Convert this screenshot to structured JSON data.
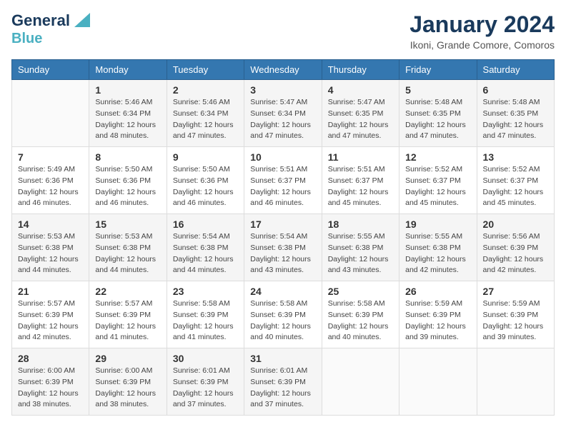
{
  "logo": {
    "line1": "General",
    "line2": "Blue"
  },
  "title": "January 2024",
  "subtitle": "Ikoni, Grande Comore, Comoros",
  "days_of_week": [
    "Sunday",
    "Monday",
    "Tuesday",
    "Wednesday",
    "Thursday",
    "Friday",
    "Saturday"
  ],
  "weeks": [
    [
      {
        "day": "",
        "sunrise": "",
        "sunset": "",
        "daylight": "",
        "extra": ""
      },
      {
        "day": "1",
        "sunrise": "Sunrise: 5:46 AM",
        "sunset": "Sunset: 6:34 PM",
        "daylight": "Daylight: 12 hours",
        "extra": "and 48 minutes."
      },
      {
        "day": "2",
        "sunrise": "Sunrise: 5:46 AM",
        "sunset": "Sunset: 6:34 PM",
        "daylight": "Daylight: 12 hours",
        "extra": "and 47 minutes."
      },
      {
        "day": "3",
        "sunrise": "Sunrise: 5:47 AM",
        "sunset": "Sunset: 6:34 PM",
        "daylight": "Daylight: 12 hours",
        "extra": "and 47 minutes."
      },
      {
        "day": "4",
        "sunrise": "Sunrise: 5:47 AM",
        "sunset": "Sunset: 6:35 PM",
        "daylight": "Daylight: 12 hours",
        "extra": "and 47 minutes."
      },
      {
        "day": "5",
        "sunrise": "Sunrise: 5:48 AM",
        "sunset": "Sunset: 6:35 PM",
        "daylight": "Daylight: 12 hours",
        "extra": "and 47 minutes."
      },
      {
        "day": "6",
        "sunrise": "Sunrise: 5:48 AM",
        "sunset": "Sunset: 6:35 PM",
        "daylight": "Daylight: 12 hours",
        "extra": "and 47 minutes."
      }
    ],
    [
      {
        "day": "7",
        "sunrise": "Sunrise: 5:49 AM",
        "sunset": "Sunset: 6:36 PM",
        "daylight": "Daylight: 12 hours",
        "extra": "and 46 minutes."
      },
      {
        "day": "8",
        "sunrise": "Sunrise: 5:50 AM",
        "sunset": "Sunset: 6:36 PM",
        "daylight": "Daylight: 12 hours",
        "extra": "and 46 minutes."
      },
      {
        "day": "9",
        "sunrise": "Sunrise: 5:50 AM",
        "sunset": "Sunset: 6:36 PM",
        "daylight": "Daylight: 12 hours",
        "extra": "and 46 minutes."
      },
      {
        "day": "10",
        "sunrise": "Sunrise: 5:51 AM",
        "sunset": "Sunset: 6:37 PM",
        "daylight": "Daylight: 12 hours",
        "extra": "and 46 minutes."
      },
      {
        "day": "11",
        "sunrise": "Sunrise: 5:51 AM",
        "sunset": "Sunset: 6:37 PM",
        "daylight": "Daylight: 12 hours",
        "extra": "and 45 minutes."
      },
      {
        "day": "12",
        "sunrise": "Sunrise: 5:52 AM",
        "sunset": "Sunset: 6:37 PM",
        "daylight": "Daylight: 12 hours",
        "extra": "and 45 minutes."
      },
      {
        "day": "13",
        "sunrise": "Sunrise: 5:52 AM",
        "sunset": "Sunset: 6:37 PM",
        "daylight": "Daylight: 12 hours",
        "extra": "and 45 minutes."
      }
    ],
    [
      {
        "day": "14",
        "sunrise": "Sunrise: 5:53 AM",
        "sunset": "Sunset: 6:38 PM",
        "daylight": "Daylight: 12 hours",
        "extra": "and 44 minutes."
      },
      {
        "day": "15",
        "sunrise": "Sunrise: 5:53 AM",
        "sunset": "Sunset: 6:38 PM",
        "daylight": "Daylight: 12 hours",
        "extra": "and 44 minutes."
      },
      {
        "day": "16",
        "sunrise": "Sunrise: 5:54 AM",
        "sunset": "Sunset: 6:38 PM",
        "daylight": "Daylight: 12 hours",
        "extra": "and 44 minutes."
      },
      {
        "day": "17",
        "sunrise": "Sunrise: 5:54 AM",
        "sunset": "Sunset: 6:38 PM",
        "daylight": "Daylight: 12 hours",
        "extra": "and 43 minutes."
      },
      {
        "day": "18",
        "sunrise": "Sunrise: 5:55 AM",
        "sunset": "Sunset: 6:38 PM",
        "daylight": "Daylight: 12 hours",
        "extra": "and 43 minutes."
      },
      {
        "day": "19",
        "sunrise": "Sunrise: 5:55 AM",
        "sunset": "Sunset: 6:38 PM",
        "daylight": "Daylight: 12 hours",
        "extra": "and 42 minutes."
      },
      {
        "day": "20",
        "sunrise": "Sunrise: 5:56 AM",
        "sunset": "Sunset: 6:39 PM",
        "daylight": "Daylight: 12 hours",
        "extra": "and 42 minutes."
      }
    ],
    [
      {
        "day": "21",
        "sunrise": "Sunrise: 5:57 AM",
        "sunset": "Sunset: 6:39 PM",
        "daylight": "Daylight: 12 hours",
        "extra": "and 42 minutes."
      },
      {
        "day": "22",
        "sunrise": "Sunrise: 5:57 AM",
        "sunset": "Sunset: 6:39 PM",
        "daylight": "Daylight: 12 hours",
        "extra": "and 41 minutes."
      },
      {
        "day": "23",
        "sunrise": "Sunrise: 5:58 AM",
        "sunset": "Sunset: 6:39 PM",
        "daylight": "Daylight: 12 hours",
        "extra": "and 41 minutes."
      },
      {
        "day": "24",
        "sunrise": "Sunrise: 5:58 AM",
        "sunset": "Sunset: 6:39 PM",
        "daylight": "Daylight: 12 hours",
        "extra": "and 40 minutes."
      },
      {
        "day": "25",
        "sunrise": "Sunrise: 5:58 AM",
        "sunset": "Sunset: 6:39 PM",
        "daylight": "Daylight: 12 hours",
        "extra": "and 40 minutes."
      },
      {
        "day": "26",
        "sunrise": "Sunrise: 5:59 AM",
        "sunset": "Sunset: 6:39 PM",
        "daylight": "Daylight: 12 hours",
        "extra": "and 39 minutes."
      },
      {
        "day": "27",
        "sunrise": "Sunrise: 5:59 AM",
        "sunset": "Sunset: 6:39 PM",
        "daylight": "Daylight: 12 hours",
        "extra": "and 39 minutes."
      }
    ],
    [
      {
        "day": "28",
        "sunrise": "Sunrise: 6:00 AM",
        "sunset": "Sunset: 6:39 PM",
        "daylight": "Daylight: 12 hours",
        "extra": "and 38 minutes."
      },
      {
        "day": "29",
        "sunrise": "Sunrise: 6:00 AM",
        "sunset": "Sunset: 6:39 PM",
        "daylight": "Daylight: 12 hours",
        "extra": "and 38 minutes."
      },
      {
        "day": "30",
        "sunrise": "Sunrise: 6:01 AM",
        "sunset": "Sunset: 6:39 PM",
        "daylight": "Daylight: 12 hours",
        "extra": "and 37 minutes."
      },
      {
        "day": "31",
        "sunrise": "Sunrise: 6:01 AM",
        "sunset": "Sunset: 6:39 PM",
        "daylight": "Daylight: 12 hours",
        "extra": "and 37 minutes."
      },
      {
        "day": "",
        "sunrise": "",
        "sunset": "",
        "daylight": "",
        "extra": ""
      },
      {
        "day": "",
        "sunrise": "",
        "sunset": "",
        "daylight": "",
        "extra": ""
      },
      {
        "day": "",
        "sunrise": "",
        "sunset": "",
        "daylight": "",
        "extra": ""
      }
    ]
  ]
}
